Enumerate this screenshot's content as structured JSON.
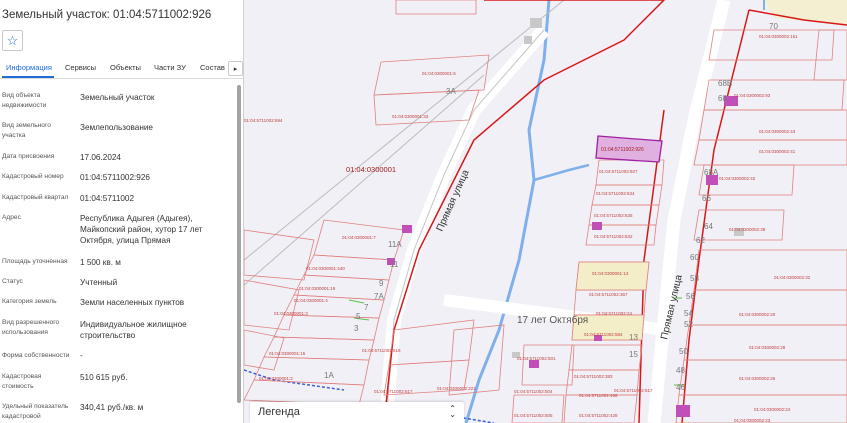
{
  "panel": {
    "title": "Земельный участок: 01:04:5711002:926",
    "tabs": [
      {
        "label": "Информация"
      },
      {
        "label": "Сервисы"
      },
      {
        "label": "Объекты"
      },
      {
        "label": "Части ЗУ"
      },
      {
        "label": "Состав"
      }
    ],
    "tab_next_icon": "chevron-right-icon",
    "star_icon": "star-outline-icon",
    "rows": [
      {
        "label": "Вид объекта недвижимости",
        "value": "Земельный участок"
      },
      {
        "label": "Вид земельного участка",
        "value": "Землепользование"
      },
      {
        "label": "Дата присвоения",
        "value": "17.06.2024"
      },
      {
        "label": "Кадастровый номер",
        "value": "01:04:5711002:926"
      },
      {
        "label": "Кадастровый квартал",
        "value": "01:04:5711002"
      },
      {
        "label": "Адрес",
        "value": "Республика Адыгея (Адыгея), Майкопский район, хутор 17 лет Октября, улица Прямая"
      },
      {
        "label": "Площадь уточненная",
        "value": "1 500 кв. м"
      },
      {
        "label": "Статус",
        "value": "Учтенный"
      },
      {
        "label": "Категория земель",
        "value": "Земли населенных пунктов"
      },
      {
        "label": "Вид разрешенного использования",
        "value": "Индивидуальное жилищное строительство"
      },
      {
        "label": "Форма собственности",
        "value": "-"
      },
      {
        "label": "Кадастровая стоимость",
        "value": "510 615 руб."
      },
      {
        "label": "Удельный показатель кадастровой",
        "value": "340,41 руб./кв. м"
      }
    ]
  },
  "map": {
    "street_label": "Прямая улица",
    "village_label": "17 лет Октября",
    "quarter_label": "01:04:0300001",
    "selected_parcel": "01:04:5711002:926",
    "parcel_labels": [
      "01:04:0300001:6",
      "01:04:0300001:33",
      "01:04:0300001:7",
      "01:04:0300001:440",
      "01:04:0300001:19",
      "01:04:0300001:4",
      "01:04:0300001:3",
      "01:04:0300001:15",
      "01:04:0300001:2",
      "01:04:5711002:618",
      "01:04:5711002:927",
      "01:04:5711002:634",
      "01:04:5711002:635",
      "01:04:5711002:632",
      "01:04:0300001:14",
      "01:04:5711002:367",
      "01:04:5711002:24",
      "01:04:5711002:584",
      "01:04:5711002:501",
      "01:04:5711002:383",
      "01:04:5711002:504",
      "01:04:5711002:466",
      "01:04:5711002:505",
      "01:04:5711002:428",
      "01:04:0300002:221",
      "01:04:0300002:161",
      "01:04:0300002:93",
      "01:04:0300002:43",
      "01:04:0300002:41",
      "01:04:0300002:42",
      "01:04:0300002:38",
      "01:04:0300002:32",
      "01:04:0300002:20",
      "01:04:0300002:28",
      "01:04:0300002:26",
      "01:04:0300002:24",
      "01:04:0300002:23",
      "01:04:5711002:694",
      "01:04:5711002:617",
      "01:04:5711002:517"
    ],
    "house_numbers": [
      "3А",
      "70",
      "68В",
      "68",
      "68А",
      "66",
      "64",
      "62",
      "60",
      "58",
      "56",
      "54",
      "52",
      "50",
      "48",
      "46",
      "11А",
      "11",
      "9",
      "7А",
      "7",
      "5",
      "3",
      "1А",
      "13",
      "15"
    ]
  },
  "legend": {
    "label": "Легенда",
    "icon": "chevron-up-down-icon"
  },
  "colors": {
    "accent": "#1e6bd6",
    "parcel_border": "#e08080",
    "quarter_border": "#d81818",
    "water": "#7fb0ec",
    "selected_fill": "#d890d8",
    "building": "#c050b8"
  }
}
